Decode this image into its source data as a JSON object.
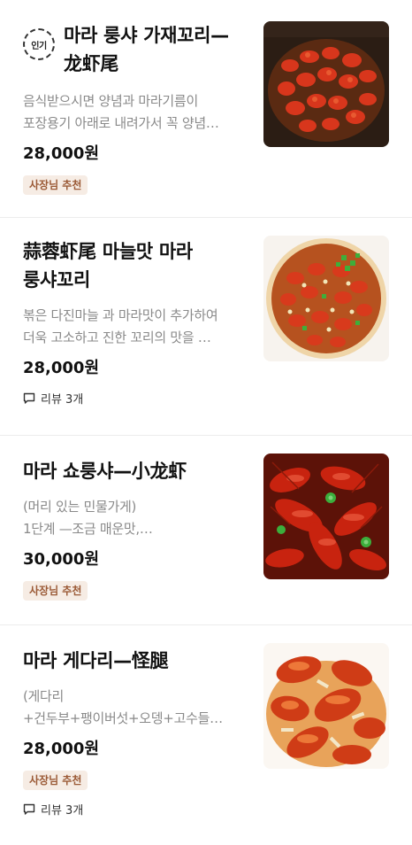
{
  "items": [
    {
      "popular_badge": "인기",
      "title": "마라 룽샤 가재꼬리—龙虾尾",
      "desc_lines": [
        "음식받으시면 양념과 마라기름이",
        "포장용기 아래로 내려가서 꼭 양념…"
      ],
      "price": "28,000원",
      "owner_badge": "사장님 추천",
      "image_icon": "crayfish-tails-photo"
    },
    {
      "title": "蒜蓉虾尾 마늘맛 마라 룽샤꼬리",
      "desc_lines": [
        "볶은 다진마늘 과 마라맛이 추가하여",
        "더욱  고소하고 진한 꼬리의 맛을 …"
      ],
      "price": "28,000원",
      "review": "리뷰 3개",
      "image_icon": "garlic-crayfish-photo"
    },
    {
      "title": "마라 쇼룽샤—小龙虾",
      "desc_lines": [
        "(머리 있는 민물가게)",
        "1단계 —조금 매운맛,…"
      ],
      "price": "30,000원",
      "owner_badge": "사장님 추천",
      "image_icon": "whole-crayfish-photo"
    },
    {
      "title": "마라 게다리—怪腿",
      "desc_lines": [
        "(게다리",
        "+건두부+팽이버섯+오뎅+고수들…"
      ],
      "price": "28,000원",
      "owner_badge": "사장님 추천",
      "review": "리뷰 3개",
      "image_icon": "crab-legs-photo"
    }
  ],
  "colors": {
    "owner_badge_bg": "#f6ece4",
    "owner_badge_text": "#9b5a36",
    "desc_text": "#8a8a8a",
    "divider": "#ececec"
  }
}
